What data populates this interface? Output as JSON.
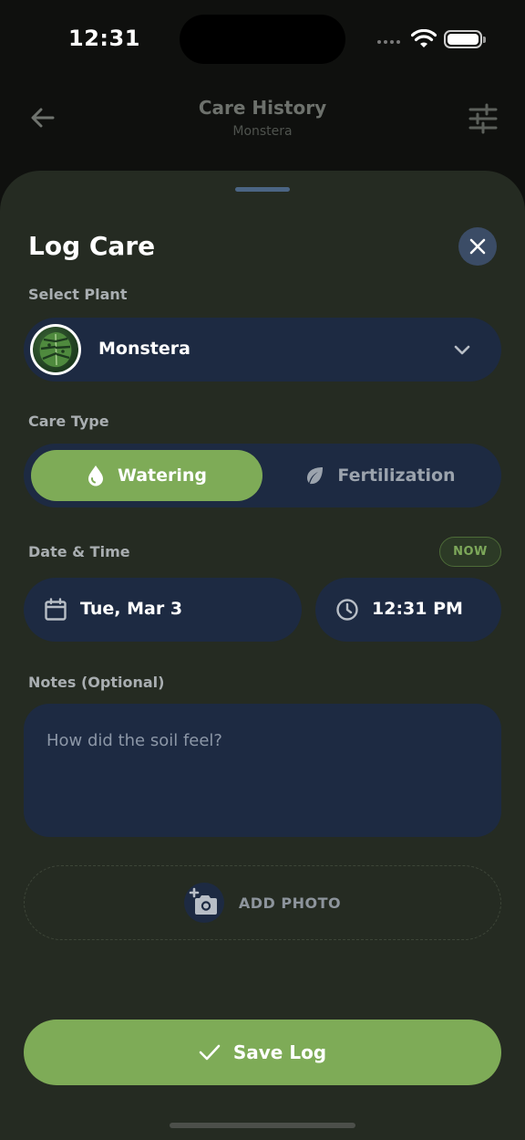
{
  "status_bar": {
    "time": "12:31"
  },
  "header": {
    "title": "Care History",
    "subtitle": "Monstera"
  },
  "sheet": {
    "title": "Log Care",
    "select_plant": {
      "label": "Select Plant",
      "value": "Monstera"
    },
    "care_type": {
      "label": "Care Type",
      "options": [
        {
          "label": "Watering",
          "selected": true,
          "icon": "water-drop-icon"
        },
        {
          "label": "Fertilization",
          "selected": false,
          "icon": "leaf-icon"
        }
      ]
    },
    "date_time": {
      "label": "Date & Time",
      "now_badge": "NOW",
      "date": "Tue, Mar 3",
      "time": "12:31 PM"
    },
    "notes": {
      "label": "Notes (Optional)",
      "placeholder": "How did the soil feel?"
    },
    "add_photo": "ADD PHOTO",
    "save": "Save Log"
  },
  "colors": {
    "accent": "#7eab57",
    "field_bg": "#1d2a42",
    "sheet_bg": "#252b22"
  }
}
